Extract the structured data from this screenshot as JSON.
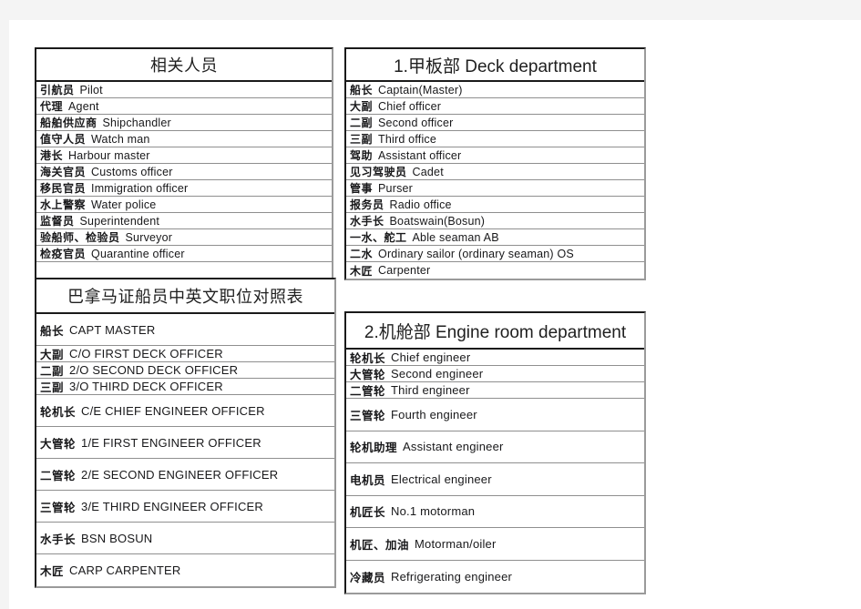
{
  "page": {
    "background": "#ffffff",
    "chrome_band_color": "#f4f4f4"
  },
  "tables": {
    "related_personnel": {
      "title": "相关人员",
      "rows": [
        {
          "cn": "引航员",
          "en": "Pilot"
        },
        {
          "cn": "代理",
          "en": "Agent"
        },
        {
          "cn": "船舶供应商",
          "en": "Shipchandler"
        },
        {
          "cn": "值守人员",
          "en": "Watch man"
        },
        {
          "cn": "港长",
          "en": "Harbour master"
        },
        {
          "cn": "海关官员",
          "en": "Customs officer"
        },
        {
          "cn": "移民官员",
          "en": "Immigration officer"
        },
        {
          "cn": "水上警察",
          "en": "Water police"
        },
        {
          "cn": "监督员",
          "en": "Superintendent"
        },
        {
          "cn": "验船师、检验员",
          "en": "Surveyor"
        },
        {
          "cn": "检疫官员",
          "en": "Quarantine officer"
        }
      ]
    },
    "panama_certificate": {
      "title": "巴拿马证船员中英文职位对照表",
      "rows": [
        {
          "cn": "船长",
          "en": "CAPT MASTER",
          "tall": true
        },
        {
          "cn": "大副",
          "en": "C/O FIRST DECK OFFICER",
          "tall": false
        },
        {
          "cn": "二副",
          "en": "2/O SECOND DECK OFFICER",
          "tall": false
        },
        {
          "cn": "三副",
          "en": "3/O THIRD DECK OFFICER",
          "tall": false
        },
        {
          "cn": "轮机长",
          "en": "C/E CHIEF ENGINEER OFFICER",
          "tall": true
        },
        {
          "cn": "大管轮",
          "en": "1/E FIRST ENGINEER OFFICER",
          "tall": true
        },
        {
          "cn": "二管轮",
          "en": "2/E SECOND ENGINEER OFFICER",
          "tall": true
        },
        {
          "cn": "三管轮",
          "en": "3/E THIRD ENGINEER OFFICER",
          "tall": true
        },
        {
          "cn": "水手长",
          "en": "BSN BOSUN",
          "tall": true
        },
        {
          "cn": "木匠",
          "en": "CARP CARPENTER",
          "tall": true
        }
      ]
    },
    "deck_department": {
      "title": "1.甲板部 Deck department",
      "rows": [
        {
          "cn": "船长",
          "en": "Captain(Master)"
        },
        {
          "cn": "大副",
          "en": "Chief officer"
        },
        {
          "cn": "二副",
          "en": "Second officer"
        },
        {
          "cn": "三副",
          "en": "Third office"
        },
        {
          "cn": "驾助",
          "en": "Assistant officer"
        },
        {
          "cn": "见习驾驶员",
          "en": "Cadet"
        },
        {
          "cn": "管事",
          "en": "Purser"
        },
        {
          "cn": "报务员",
          "en": "Radio office"
        },
        {
          "cn": "水手长",
          "en": "Boatswain(Bosun)"
        },
        {
          "cn": "一水、舵工",
          "en": "Able seaman AB"
        },
        {
          "cn": "二水",
          "en": "Ordinary sailor (ordinary seaman) OS"
        },
        {
          "cn": "木匠",
          "en": "Carpenter"
        }
      ]
    },
    "engine_room_department": {
      "title": "2.机舱部 Engine room department",
      "rows": [
        {
          "cn": "轮机长",
          "en": "Chief engineer",
          "tall": false
        },
        {
          "cn": "大管轮",
          "en": "Second engineer",
          "tall": false
        },
        {
          "cn": "二管轮",
          "en": "Third engineer",
          "tall": false
        },
        {
          "cn": "三管轮",
          "en": "Fourth engineer",
          "tall": true
        },
        {
          "cn": "轮机助理",
          "en": "Assistant engineer",
          "tall": true
        },
        {
          "cn": "电机员",
          "en": "Electrical engineer",
          "tall": true
        },
        {
          "cn": "机匠长",
          "en": "No.1 motorman",
          "tall": true
        },
        {
          "cn": "机匠、加油",
          "en": "Motorman/oiler",
          "tall": true
        },
        {
          "cn": "冷藏员",
          "en": "Refrigerating engineer",
          "tall": true
        }
      ]
    }
  }
}
